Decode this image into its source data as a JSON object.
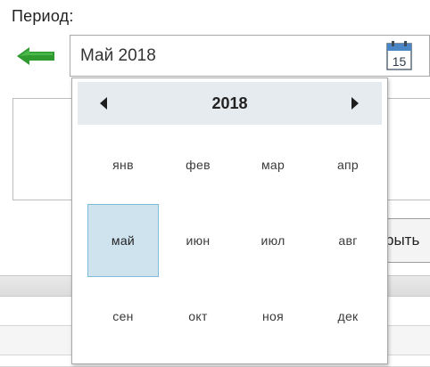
{
  "period_label": "Период:",
  "date_input": {
    "value": "Май 2018",
    "calendar_icon_day": "15"
  },
  "background": {
    "partial_button_label": "рыть"
  },
  "picker": {
    "year": "2018",
    "selected_month_index": 4,
    "months": [
      "янв",
      "фев",
      "мар",
      "апр",
      "май",
      "июн",
      "июл",
      "авг",
      "сен",
      "окт",
      "ноя",
      "дек"
    ]
  },
  "colors": {
    "arrow_green": "#2f9a2f",
    "header_bg": "#e6ebef",
    "selected_bg": "#cfe3ef",
    "selected_border": "#7fbcd9"
  },
  "icons": {
    "prev_period": "arrow-left-icon",
    "calendar": "calendar-icon",
    "nav_prev": "triangle-left-icon",
    "nav_next": "triangle-right-icon"
  }
}
